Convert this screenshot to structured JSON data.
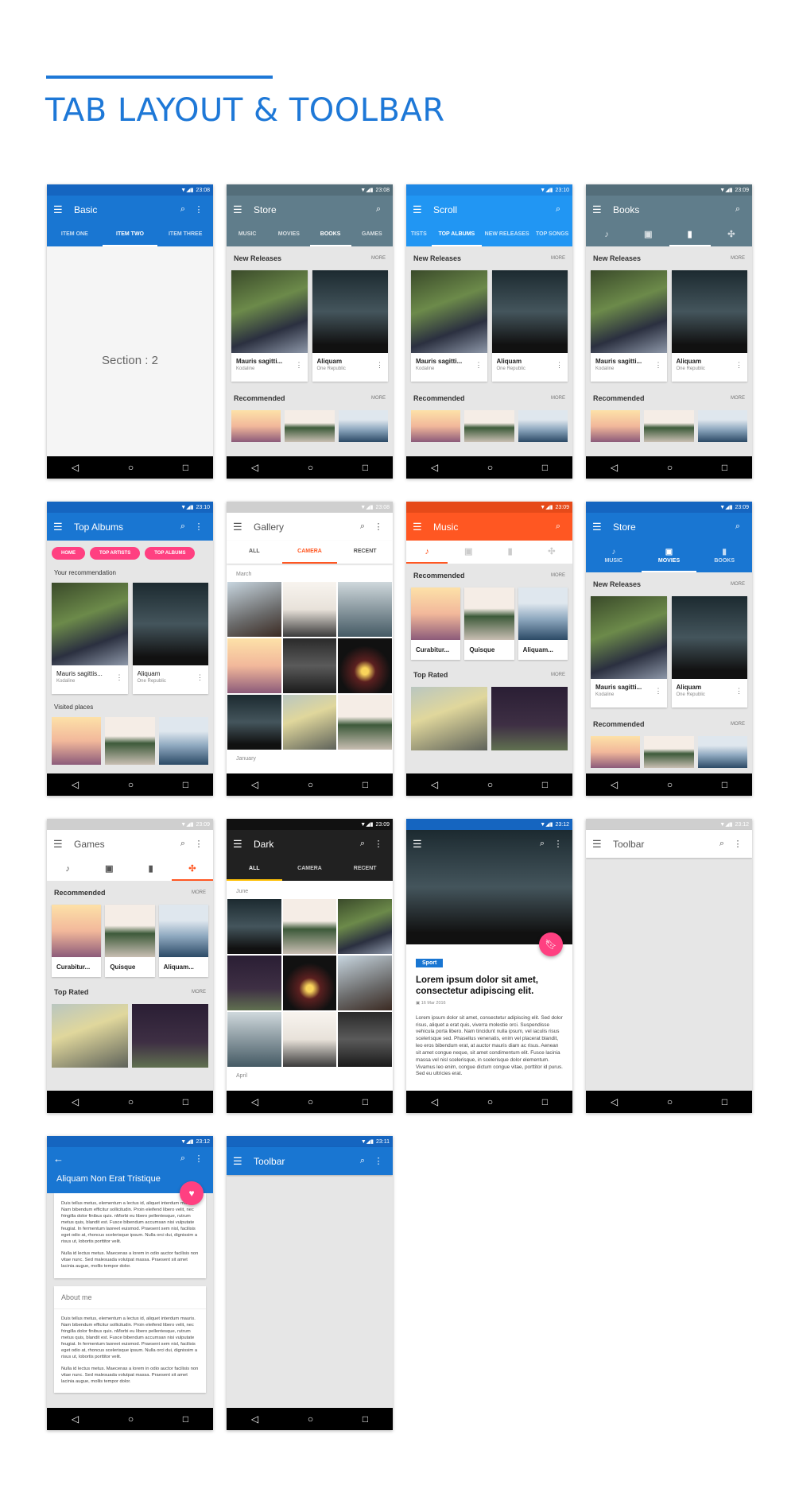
{
  "page": {
    "title": "TAB LAYOUT & TOOLBAR",
    "accent": "#1e78d7"
  },
  "common": {
    "more": "MORE",
    "new_releases": "New Releases",
    "recommended": "Recommended",
    "top_rated": "Top Rated",
    "album_cards": [
      {
        "title": "Mauris sagitti...",
        "artist": "Kodaline"
      },
      {
        "title": "Aliquam",
        "artist": "One Republic"
      }
    ],
    "square_cards": [
      "Curabitur...",
      "Quisque",
      "Aliquam..."
    ],
    "nav": {
      "back": "◁",
      "home": "○",
      "recents": "□"
    },
    "status_icons": "▼◢▮"
  },
  "screens": {
    "basic": {
      "time": "23:08",
      "title": "Basic",
      "tabs": [
        "ITEM ONE",
        "ITEM TWO",
        "ITEM THREE"
      ],
      "active": 1,
      "section": "Section : 2",
      "color": "#1976d2"
    },
    "store": {
      "time": "23:08",
      "title": "Store",
      "tabs": [
        "MUSIC",
        "MOVIES",
        "BOOKS",
        "GAMES"
      ],
      "active": 2,
      "color": "#607d8b"
    },
    "scroll": {
      "time": "23:10",
      "title": "Scroll",
      "tabs": [
        "TISTS",
        "TOP ALBUMS",
        "NEW RELEASES",
        "TOP SONGS"
      ],
      "active": 1,
      "color": "#2196f3"
    },
    "books": {
      "time": "23:09",
      "title": "Books",
      "active": 2,
      "color": "#607d8b"
    },
    "top_albums": {
      "time": "23:10",
      "title": "Top Albums",
      "chips": [
        "HOME",
        "TOP ARTISTS",
        "TOP ALBUMS"
      ],
      "subtitle": "Your recommendation",
      "visited": "Visited places",
      "album_cards": [
        {
          "title": "Mauris sagittis...",
          "artist": "Kodaline"
        },
        {
          "title": "Aliquam",
          "artist": "One Republic"
        }
      ]
    },
    "gallery": {
      "time": "23:08",
      "title": "Gallery",
      "tabs": [
        "ALL",
        "CAMERA",
        "RECENT"
      ],
      "active": 1,
      "month1": "March",
      "month2": "January",
      "accent": "#ff5722"
    },
    "music": {
      "time": "23:09",
      "title": "Music",
      "active": 0,
      "color": "#ff5722"
    },
    "store2": {
      "time": "23:09",
      "title": "Store",
      "tabs": [
        "MUSIC",
        "MOVIES",
        "BOOKS"
      ],
      "active": 1,
      "color": "#1976d2"
    },
    "games": {
      "time": "23:09",
      "title": "Games",
      "active": 3
    },
    "dark": {
      "time": "23:09",
      "title": "Dark",
      "tabs": [
        "ALL",
        "CAMERA",
        "RECENT"
      ],
      "active": 0,
      "month1": "June",
      "month2": "April",
      "accent": "#ffc107"
    },
    "article": {
      "time": "23:12",
      "tag": "Sport",
      "headline": "Lorem ipsum dolor sit amet, consectetur adipiscing elit.",
      "date": "16 Mar 2016",
      "body": "Lorem ipsum dolor sit amet, consectetur adipiscing elit. Sed dolor risus, aliquet a erat quis, viverra molestie orci. Suspendisse vehicula porta libero. Nam tincidunt nulla ipsum, vel iaculis risus scelerisque sed. Phasellus venenatis, enim vel placerat blandit, leo eros bibendum erat, at auctor mauris diam ac risus. Aenean sit amet congue neque, sit amet condimentum elit. Fusce lacinia massa vel nisl scelerisque, in scelerisque dolor elementum. Vivamus leo enim, congue dictum congue vitae, porttitor id purus. Sed eu ultricies erat."
    },
    "toolbar_light": {
      "time": "23:12",
      "title": "Toolbar"
    },
    "detail": {
      "time": "23:12",
      "title": "Aliquam Non Erat Tristique",
      "p1": "Duis tellus metus, elementum a lectus id, aliquet interdum mauris. Nam bibendum efficitur sollicitudin. Proin eleifend libero velit, nec fringilla dolor finibus quis. nMorbi eu libero pellentesque, rutrum metus quis, blandit est. Fusce bibendum accumsan nisi vulputate feugiat. In fermentum laoreet euismod. Praesent sem nisl, facilisis eget odio at, rhoncus scelerisque ipsum. Nulla orci dui, dignissim a risus ut, lobortis porttitor velit.",
      "p2": "Nulla id lectus metus. Maecenas a lorem in odio auctor facilisis non vitae nunc. Sed malesuada volutpat massa. Praesent sit amet lacinia augue, mollis tempor dolor.",
      "about": "About me"
    },
    "toolbar_blue": {
      "time": "23:11",
      "title": "Toolbar"
    }
  }
}
